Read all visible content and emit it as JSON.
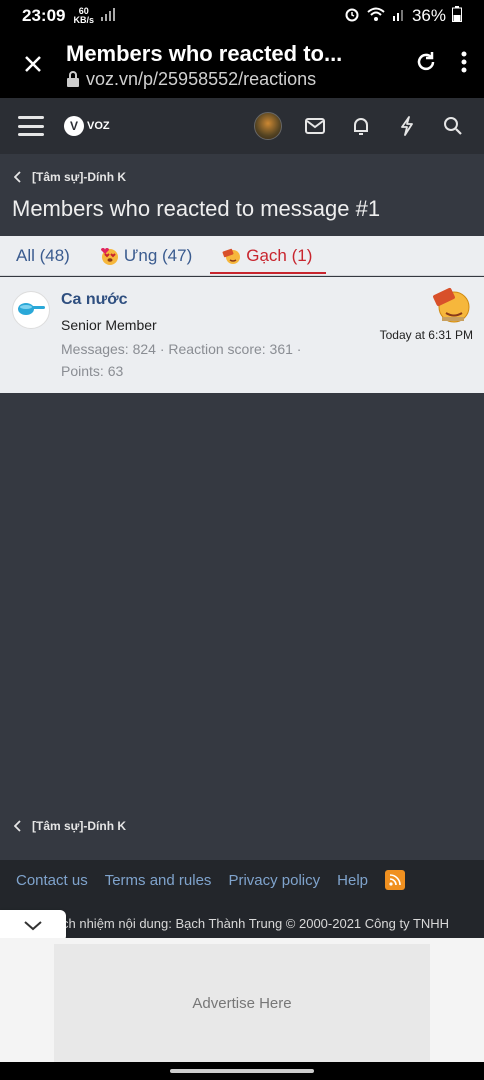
{
  "status_bar": {
    "time": "23:09",
    "speed_value": "60",
    "speed_unit": "KB/s",
    "battery": "36%"
  },
  "browser": {
    "title": "Members who reacted to...",
    "url": "voz.vn/p/25958552/reactions"
  },
  "site": {
    "logo_text": "VOZ"
  },
  "breadcrumb_top": "[Tâm sự]-Dính K",
  "page_heading": "Members who reacted to message #1",
  "tabs": [
    {
      "label": "All (48)",
      "icon": null
    },
    {
      "label": "Ưng (47)",
      "icon": "heart-face-emoji"
    },
    {
      "label": "Gạch (1)",
      "icon": "brick-emoji"
    }
  ],
  "member": {
    "name": "Ca nước",
    "role": "Senior Member",
    "stats": "Messages: 824 · Reaction score: 361 · Points: 63",
    "reaction_time": "Today at 6:31 PM",
    "reaction_icon": "brick-emoji"
  },
  "breadcrumb_bottom": "[Tâm sự]-Dính K",
  "footer": {
    "links": [
      "Contact us",
      "Terms and rules",
      "Privacy policy",
      "Help"
    ],
    "legal": "ch nhiệm nội dung: Bạch Thành Trung © 2000-2021 Công ty TNHH"
  },
  "ad": {
    "text": "Advertise Here"
  },
  "colors": {
    "page_bg": "#353941",
    "panel_bg": "#eceef1",
    "link_blue": "#3a5b8f",
    "active_red": "#c8252e",
    "footer_link": "#7fa3cc"
  }
}
